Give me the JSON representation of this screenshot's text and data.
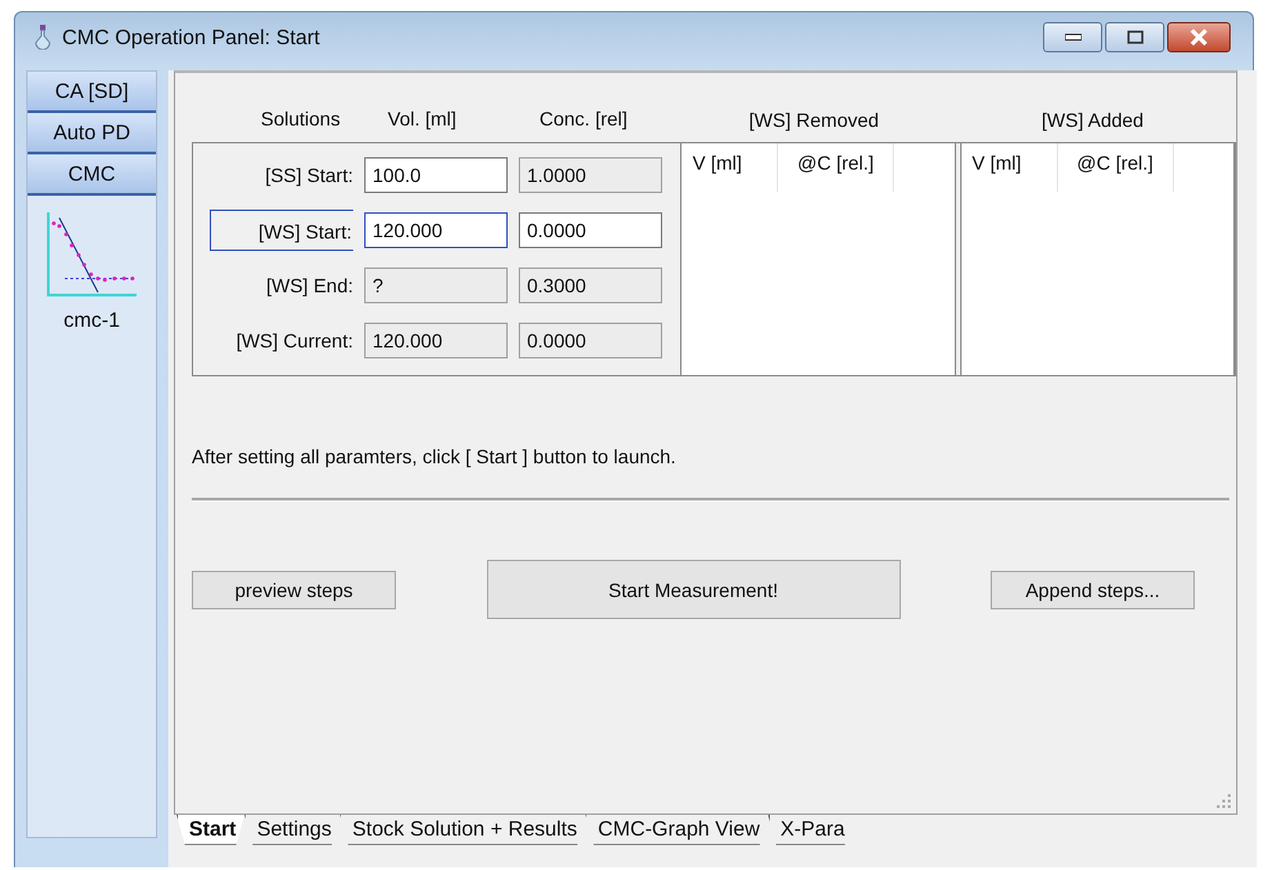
{
  "window": {
    "title": "CMC Operation Panel: Start"
  },
  "sidebar": {
    "items": [
      {
        "label": "CA [SD]"
      },
      {
        "label": "Auto PD"
      },
      {
        "label": "CMC"
      }
    ],
    "thumbnail_caption": "cmc-1"
  },
  "solutions": {
    "headers": [
      "Solutions",
      "Vol. [ml]",
      "Conc. [rel]"
    ],
    "rows": [
      {
        "label": "[SS] Start:",
        "focused": false,
        "volume": {
          "value": "100.0",
          "editable": true
        },
        "conc": {
          "value": "1.0000",
          "editable": false
        }
      },
      {
        "label": "[WS] Start:",
        "focused": true,
        "volume": {
          "value": "120.000",
          "editable": true
        },
        "conc": {
          "value": "0.0000",
          "editable": true
        }
      },
      {
        "label": "[WS] End:",
        "focused": false,
        "volume": {
          "value": "?",
          "editable": false
        },
        "conc": {
          "value": "0.3000",
          "editable": false
        }
      },
      {
        "label": "[WS] Current:",
        "focused": false,
        "volume": {
          "value": "120.000",
          "editable": false
        },
        "conc": {
          "value": "0.0000",
          "editable": false
        }
      }
    ]
  },
  "lists": [
    {
      "title": "[WS] Removed",
      "columns": [
        "V [ml]",
        "@C [rel.]"
      ]
    },
    {
      "title": "[WS] Added",
      "columns": [
        "V [ml]",
        "@C [rel.]"
      ]
    }
  ],
  "message": "After setting all paramters, click [ Start ] button to launch.",
  "buttons": [
    {
      "label": "preview steps",
      "kind": "small"
    },
    {
      "label": "Start Measurement!",
      "kind": "large"
    },
    {
      "label": "Append steps...",
      "kind": "small"
    }
  ],
  "tabs": [
    {
      "label": "Start",
      "selected": true
    },
    {
      "label": "Settings",
      "selected": false
    },
    {
      "label": "Stock Solution + Results",
      "selected": false
    },
    {
      "label": "CMC-Graph View",
      "selected": false
    },
    {
      "label": "X-Para",
      "selected": false
    }
  ]
}
